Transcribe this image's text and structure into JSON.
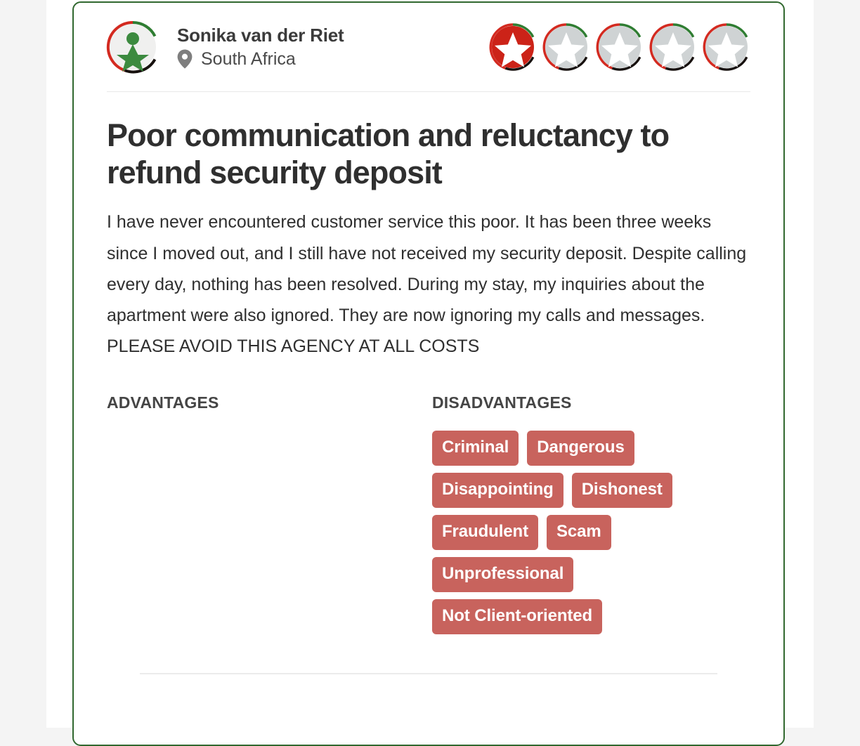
{
  "theme": {
    "page_background": "#f4f4f4",
    "card_background": "#ffffff",
    "card_border": "#31682f",
    "star_filled": "#cc2318",
    "star_empty": "#cfd3d4",
    "tag_negative": "#c8635d",
    "tag_positive": "#5f9e5c",
    "text_primary": "#2f2f2f",
    "text_muted": "#4a4a4a"
  },
  "review": {
    "reviewer": {
      "name": "Sonika van der Riet",
      "location": "South Africa",
      "location_icon": "map-pin-icon",
      "avatar_icon": "trustpilot-star-person-avatar"
    },
    "rating": {
      "value": 1,
      "max": 5,
      "label": "1 out of 5 stars"
    },
    "title": "Poor communication and reluctancy to refund security deposit",
    "body": "I have never encountered customer service this poor. It has been three weeks since I moved out, and I still have not received my security deposit. Despite calling every day, nothing has been resolved. During my stay, my inquiries about the apartment were also ignored. They are now ignoring my calls and messages. PLEASE AVOID THIS AGENCY AT ALL COSTS",
    "advantages": {
      "heading": "ADVANTAGES",
      "tags": []
    },
    "disadvantages": {
      "heading": "DISADVANTAGES",
      "tags": [
        "Criminal",
        "Dangerous",
        "Disappointing",
        "Dishonest",
        "Fraudulent",
        "Scam",
        "Unprofessional",
        "Not Client-oriented"
      ]
    }
  }
}
